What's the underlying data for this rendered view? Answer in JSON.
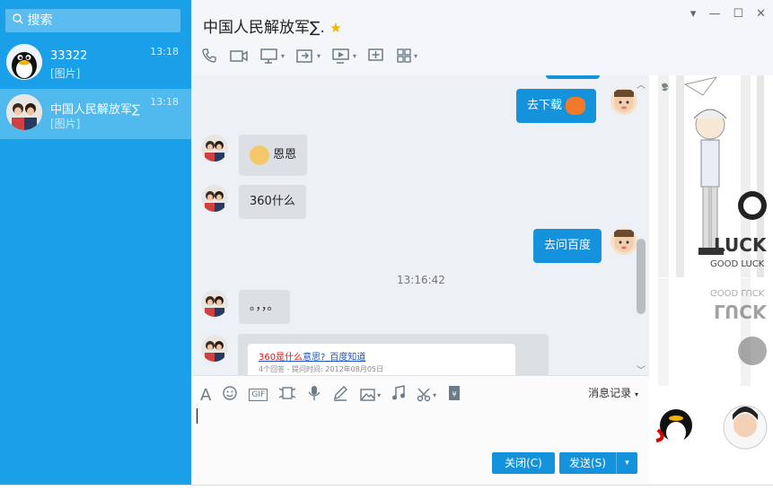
{
  "search": {
    "placeholder": "搜索"
  },
  "contacts": [
    {
      "name": "33322",
      "sub": "[图片]",
      "time": "13:18"
    },
    {
      "name": "中国人民解放军∑",
      "sub": "[图片]",
      "time": "13:18"
    }
  ],
  "header": {
    "title": "中国人民解放军∑.",
    "star": "⭐"
  },
  "messages": {
    "m1": "去下载",
    "m2": "恩恩",
    "m3": "360什么",
    "m4": "去问百度",
    "timestamp": "13:16:42",
    "m5": "。，，。",
    "card_title_hl": "360是什么",
    "card_title": "意思?_百度知道",
    "card_meta": "4个回答 - 提问时间: 2012年08月05日"
  },
  "inputbar": {
    "history": "消息记录",
    "close": "关闭(C)",
    "send": "发送(S)"
  },
  "colors": {
    "sidebar": "#1aa0e8",
    "bubble_out": "#1592dc",
    "bubble_in": "#dcdfe3"
  }
}
